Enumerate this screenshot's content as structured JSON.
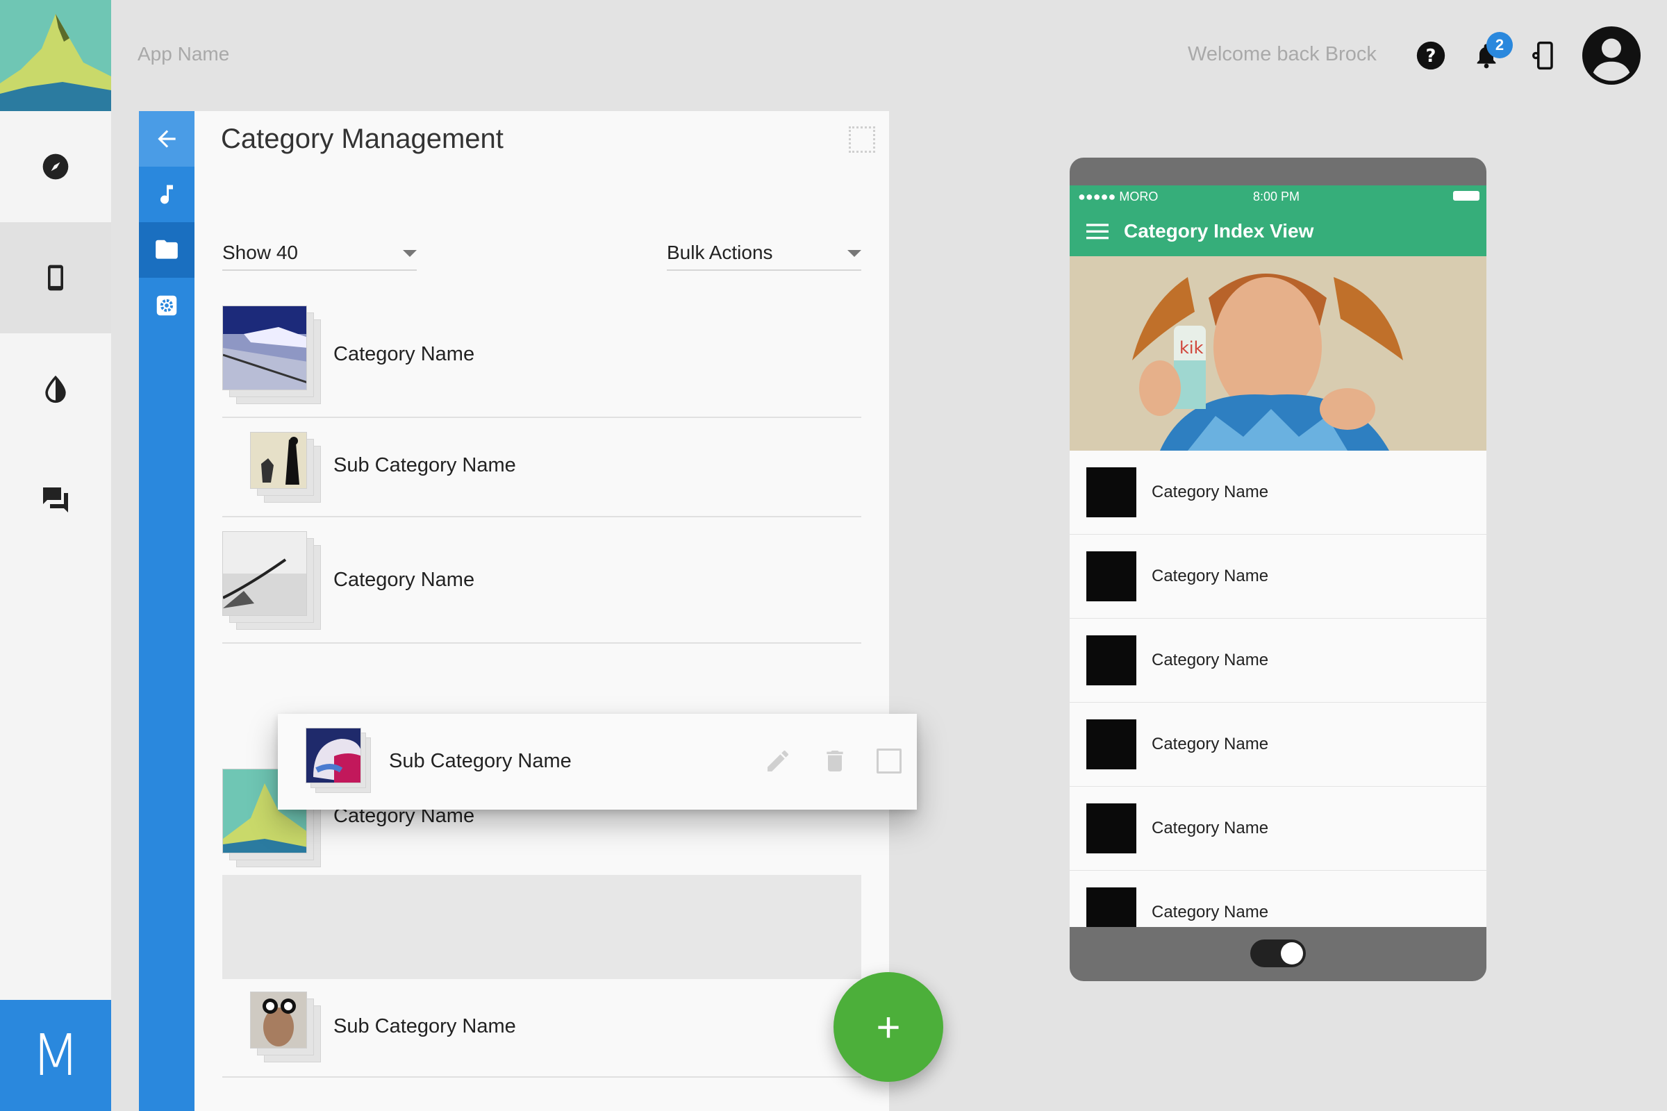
{
  "header": {
    "app_name": "App Name",
    "welcome": "Welcome back Brock",
    "notification_count": "2"
  },
  "rail": {
    "items": [
      {
        "icon": "compass-icon"
      },
      {
        "icon": "phone-device-icon"
      },
      {
        "icon": "drop-icon"
      },
      {
        "icon": "chat-icon"
      }
    ],
    "brand": "M"
  },
  "subnav": {
    "items": [
      {
        "icon": "back-arrow-icon"
      },
      {
        "icon": "music-note-icon"
      },
      {
        "icon": "folder-icon"
      },
      {
        "icon": "settings-icon"
      }
    ]
  },
  "panel": {
    "title": "Category Management",
    "show_label": "Show 40",
    "bulk_label": "Bulk Actions",
    "rows": [
      {
        "label": "Category Name"
      },
      {
        "label": "Sub Category Name"
      },
      {
        "label": "Category Name"
      },
      {
        "label": "Category Name"
      },
      {
        "label": "Sub Category Name"
      }
    ],
    "drag_card": {
      "label": "Sub Category Name"
    },
    "fab_label": "+"
  },
  "phone": {
    "carrier": "●●●●● MORO",
    "time": "8:00 PM",
    "title": "Category Index View",
    "items": [
      {
        "label": "Category Name"
      },
      {
        "label": "Category Name"
      },
      {
        "label": "Category Name"
      },
      {
        "label": "Category Name"
      },
      {
        "label": "Category Name"
      },
      {
        "label": "Category Name"
      }
    ]
  },
  "colors": {
    "primary_blue": "#2a88dd",
    "green_bar": "#36ae7a",
    "fab_green": "#4caf3a"
  }
}
